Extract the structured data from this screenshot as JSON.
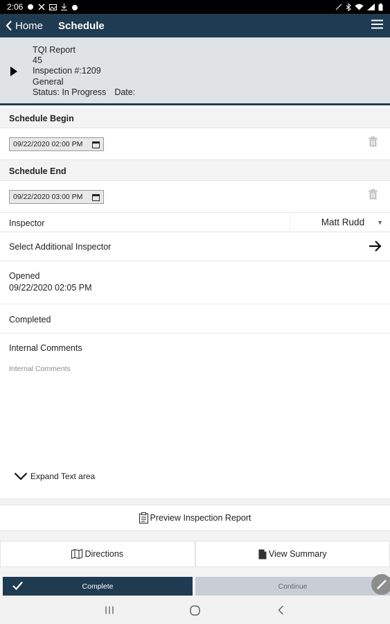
{
  "status_bar": {
    "time": "2:06"
  },
  "app_bar": {
    "back_label": "Home",
    "title": "Schedule"
  },
  "inspection": {
    "report_name": "TQI Report",
    "number_line": "45",
    "inspection_line": "Inspection #:1209",
    "category": "General",
    "status": "Status: In Progress",
    "date_label": "Date:"
  },
  "schedule_begin": {
    "label": "Schedule Begin",
    "value": "09/22/2020 02:00 PM"
  },
  "schedule_end": {
    "label": "Schedule End",
    "value": "09/22/2020 03:00 PM"
  },
  "inspector": {
    "label": "Inspector",
    "selected": "Matt Rudd"
  },
  "additional_inspector": {
    "label": "Select Additional Inspector"
  },
  "opened": {
    "label": "Opened",
    "value": "09/22/2020 02:05 PM"
  },
  "completed": {
    "label": "Completed"
  },
  "internal_comments": {
    "label": "Internal Comments",
    "placeholder": "Internal Comments",
    "expand_label": "Expand Text area"
  },
  "preview_label": "Preview Inspection Report",
  "actions": {
    "directions_label": "Directions",
    "summary_label": "View Summary"
  },
  "bottom": {
    "complete_label": "Complete",
    "continue_label": "Continue"
  },
  "colors": {
    "primary": "#1f3b52",
    "header_bg": "#dfe3e6",
    "section_bg": "#f3f3f3",
    "continue_bg": "#c8ced3"
  }
}
